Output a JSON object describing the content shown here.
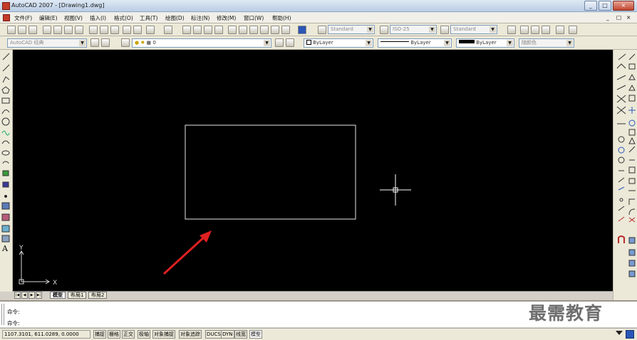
{
  "window": {
    "title": "AutoCAD 2007 - [Drawing1.dwg]",
    "controls": [
      "_",
      "□",
      "×"
    ]
  },
  "menubar": {
    "items": [
      "文件(F)",
      "编辑(E)",
      "视图(V)",
      "插入(I)",
      "格式(O)",
      "工具(T)",
      "绘图(D)",
      "标注(N)",
      "修改(M)",
      "窗口(W)",
      "帮助(H)"
    ],
    "doc_controls": [
      "_",
      "□",
      "×"
    ]
  },
  "toolbar1": {
    "text_style": "Standard",
    "dim_style": "ISO-25",
    "table_style": "Standard"
  },
  "toolbar2": {
    "workspace": "AutoCAD 经典",
    "layer": "0",
    "color": "ByLayer",
    "linetype": "ByLayer",
    "lineweight": "ByLayer",
    "plot_style": "随颜色"
  },
  "canvas": {
    "background": "#000000",
    "ucs_x_label": "X",
    "ucs_y_label": "Y",
    "annotation_arrow_color": "#e02020"
  },
  "layout_tabs": {
    "nav": [
      "|◀",
      "◀",
      "▶",
      "▶|"
    ],
    "tabs": [
      "模型",
      "布局1",
      "布局2"
    ],
    "active": "模型"
  },
  "command": {
    "line1": "命令:",
    "line2": "命令:"
  },
  "watermark": "最需教育",
  "statusbar": {
    "coordinates": "1107.3101, 611.0289, 0.0000",
    "toggles": [
      "捕捉",
      "栅格",
      "正交",
      "极轴",
      "对象捕捉",
      "对象追踪",
      "DUCS",
      "DYN",
      "线宽",
      "模型"
    ],
    "active_toggles": [
      "模型"
    ]
  }
}
